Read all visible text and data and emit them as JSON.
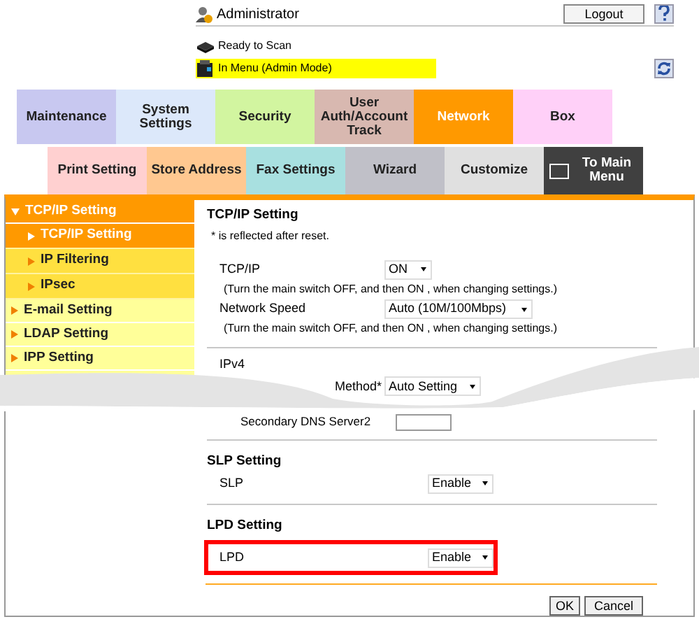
{
  "header": {
    "user": "Administrator",
    "logout": "Logout",
    "status": [
      {
        "text": "Ready to Scan",
        "highlighted": false
      },
      {
        "text": "In Menu (Admin Mode)",
        "highlighted": true
      }
    ]
  },
  "tabs": [
    {
      "label": "Maintenance",
      "color": "#c8c8f0",
      "selected": false
    },
    {
      "label": "System Settings",
      "color": "#dce8fa",
      "selected": false
    },
    {
      "label": "Security",
      "color": "#d2f5a0",
      "selected": false
    },
    {
      "label": "User Auth/Account Track",
      "color": "#d8b8b0",
      "selected": false
    },
    {
      "label": "Network",
      "color": "#ff9900",
      "selected": true
    },
    {
      "label": "Box",
      "color": "#ffd0f8",
      "selected": false
    }
  ],
  "subtabs": [
    {
      "label": "Print Setting",
      "color": "#ffd0d0",
      "kind": "tab"
    },
    {
      "label": "Store Address",
      "color": "#ffc890",
      "kind": "tab"
    },
    {
      "label": "Fax Settings",
      "color": "#a8e0e0",
      "kind": "tab"
    },
    {
      "label": "Wizard",
      "color": "#c0c0c8",
      "kind": "tab"
    },
    {
      "label": "Customize",
      "color": "#e0e0e0",
      "kind": "tab"
    },
    {
      "label": "To Main Menu",
      "color": "#404040",
      "kind": "home"
    }
  ],
  "sidebar": {
    "items": [
      {
        "label": "TCP/IP Setting",
        "expanded": true,
        "children": [
          {
            "label": "TCP/IP Setting",
            "selected": true
          },
          {
            "label": "IP Filtering",
            "selected": false
          },
          {
            "label": "IPsec",
            "selected": false
          }
        ]
      },
      {
        "label": "E-mail Setting",
        "expanded": false
      },
      {
        "label": "LDAP Setting",
        "expanded": false
      },
      {
        "label": "IPP Setting",
        "expanded": false
      }
    ]
  },
  "sections": [
    {
      "title": "TCP/IP Setting",
      "note": "* is reflected after reset.",
      "rows": [
        {
          "kind": "select",
          "label": "TCP/IP",
          "value": "ON",
          "highlighted": false
        },
        {
          "kind": "hint",
          "text": "(Turn the main switch OFF, and then ON , when changing settings.)"
        },
        {
          "kind": "select",
          "label": "Network Speed",
          "value": "Auto (10M/100Mbps)",
          "highlighted": false
        },
        {
          "kind": "hint",
          "text": "(Turn the main switch OFF, and then ON , when changing settings.)"
        },
        {
          "kind": "divider"
        },
        {
          "kind": "subheading",
          "text": "IPv4"
        },
        {
          "kind": "select",
          "label": "Method*",
          "value": "Auto Setting",
          "highlighted": false
        },
        {
          "kind": "input",
          "label": "Secondary DNS Server2"
        }
      ]
    },
    {
      "title": "SLP Setting",
      "rows": [
        {
          "kind": "select",
          "label": "SLP",
          "value": "Enable",
          "highlighted": false
        }
      ]
    },
    {
      "title": "LPD Setting",
      "rows": [
        {
          "kind": "select",
          "label": "LPD",
          "value": "Enable",
          "highlighted": true
        }
      ]
    }
  ],
  "buttons": [
    "OK",
    "Cancel"
  ]
}
